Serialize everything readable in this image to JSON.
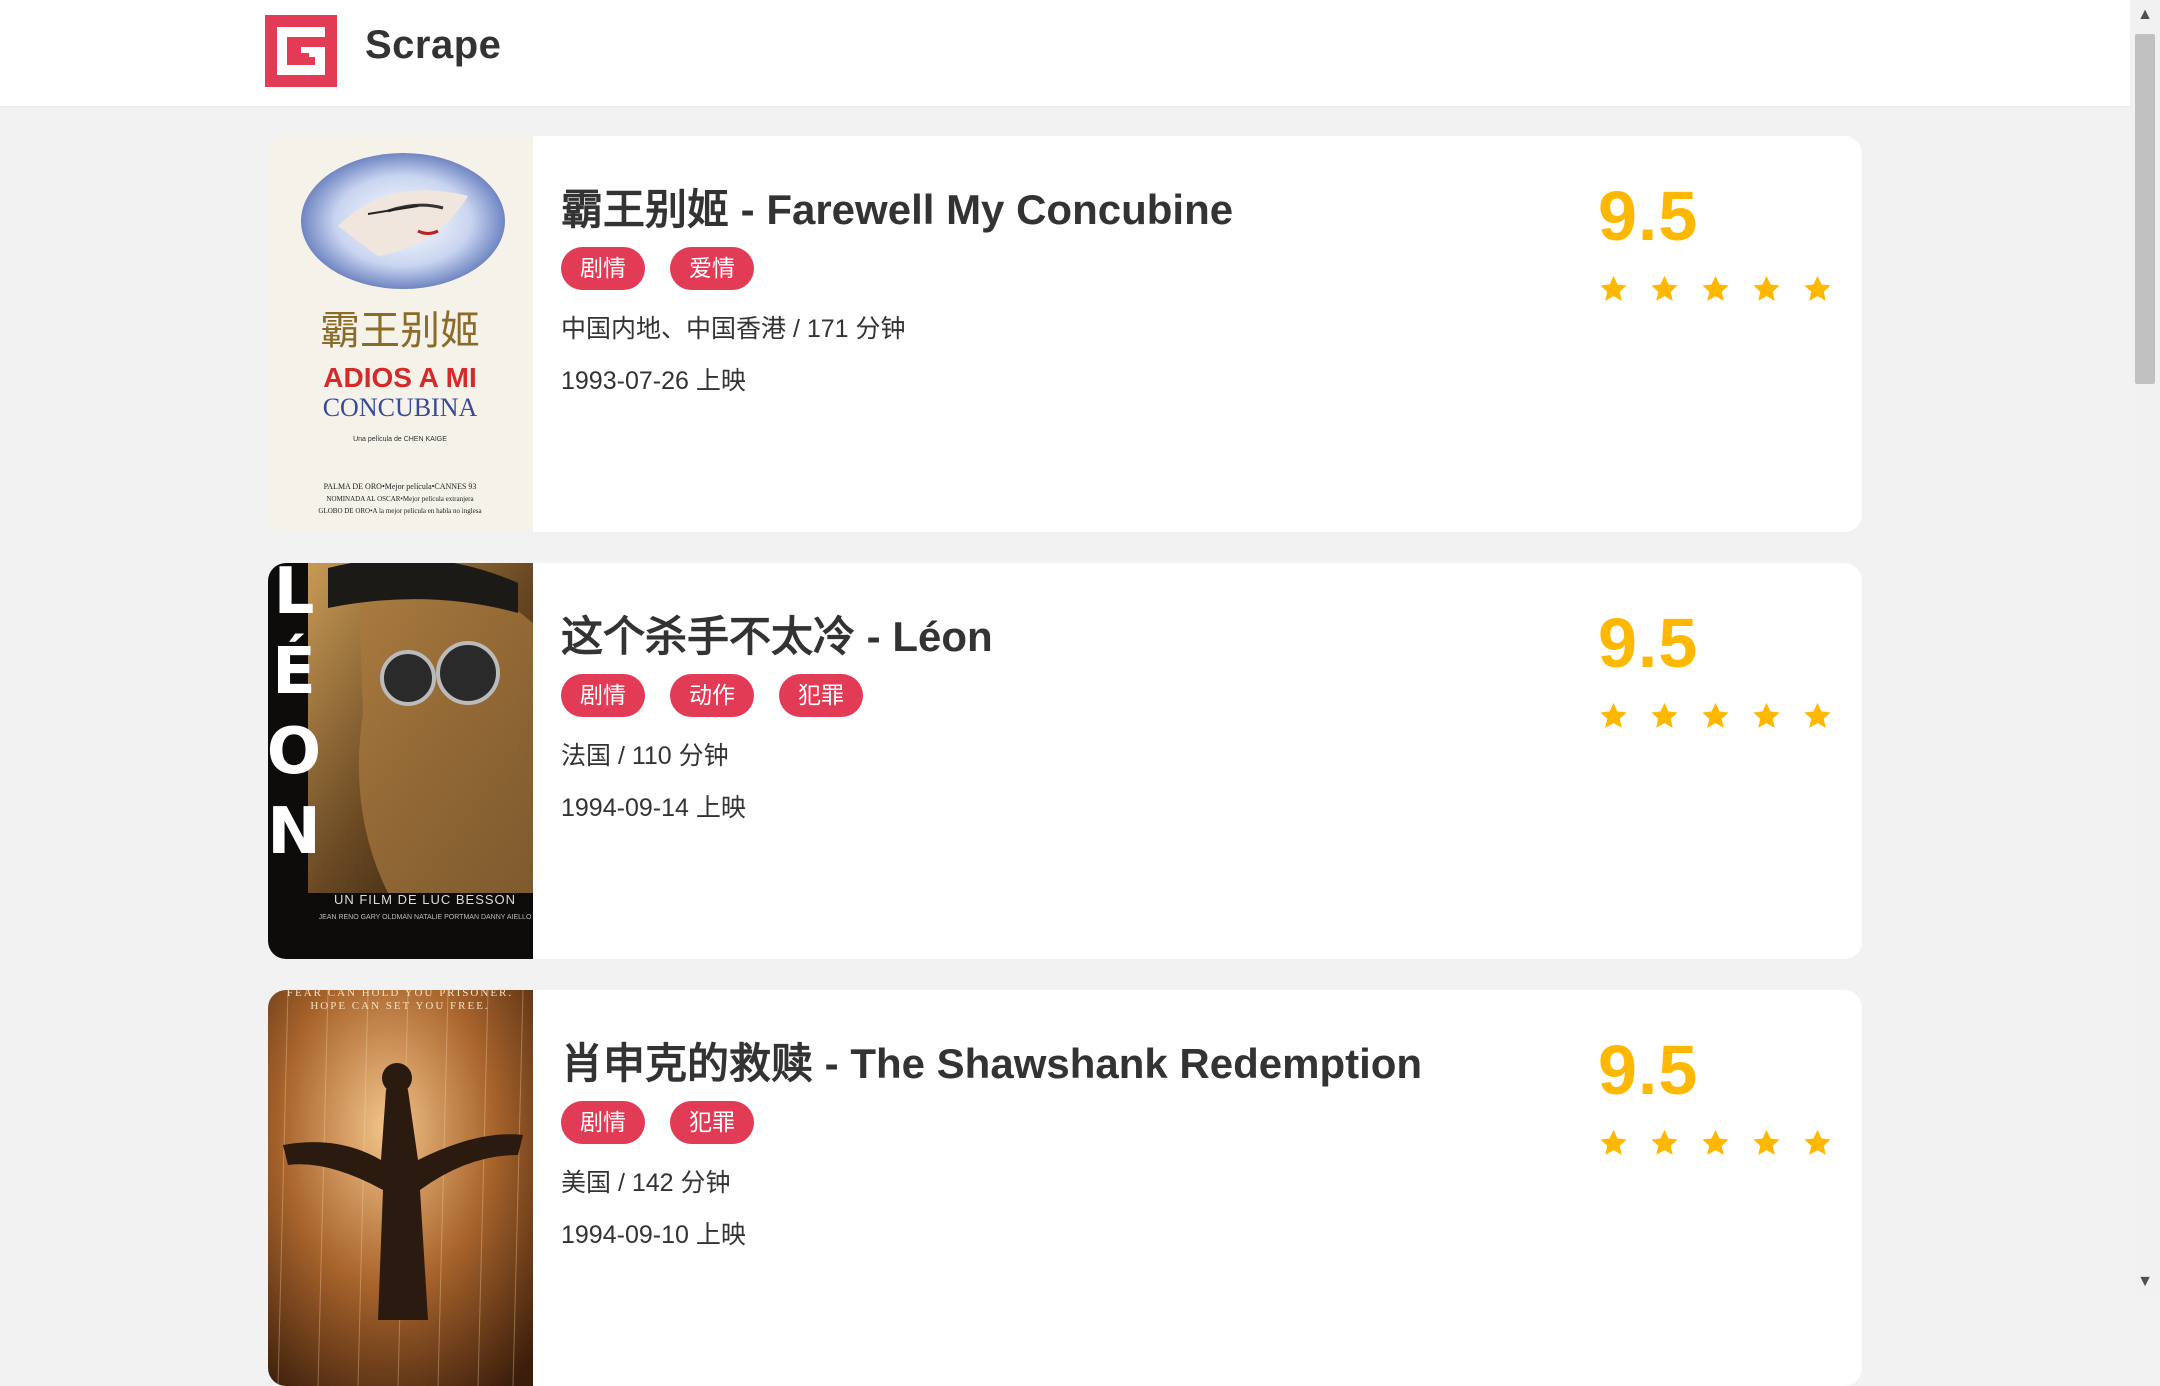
{
  "header": {
    "brand": "Scrape",
    "accent_color": "#e23b55",
    "logo_icon": "scrape-logo-icon"
  },
  "movies": [
    {
      "title": "霸王别姬 - Farewell My Concubine",
      "categories": [
        "剧情",
        "爱情"
      ],
      "meta": "中国内地、中国香港 / 171 分钟",
      "release": "1993-07-26 上映",
      "score": "9.5",
      "stars": 5,
      "poster": {
        "line1": "霸王别姬",
        "line2": "ADIOS A MI",
        "line3": "CONCUBINA",
        "credit": "Una película de CHEN KAIGE",
        "fine1": "PALMA DE ORO•Mejor película•CANNES 93",
        "fine2": "NOMINADA AL OSCAR•Mejor película extranjera",
        "fine3": "GLOBO DE ORO•A la mejor película en habla no inglesa"
      }
    },
    {
      "title": "这个杀手不太冷 - Léon",
      "categories": [
        "剧情",
        "动作",
        "犯罪"
      ],
      "meta": "法国 / 110 分钟",
      "release": "1994-09-14 上映",
      "score": "9.5",
      "stars": 5,
      "poster": {
        "vertical_title": "LÉON",
        "line1": "UN FILM DE LUC BESSON",
        "line2": "JEAN RENO  GARY OLDMAN  NATALIE PORTMAN  DANNY AIELLO"
      }
    },
    {
      "title": "肖申克的救赎 - The Shawshank Redemption",
      "categories": [
        "剧情",
        "犯罪"
      ],
      "meta": "美国 / 142 分钟",
      "release": "1994-09-10 上映",
      "score": "9.5",
      "stars": 5,
      "poster": {
        "tagline1": "FEAR CAN HOLD YOU PRISONER.",
        "tagline2": "HOPE CAN SET YOU FREE."
      }
    }
  ]
}
